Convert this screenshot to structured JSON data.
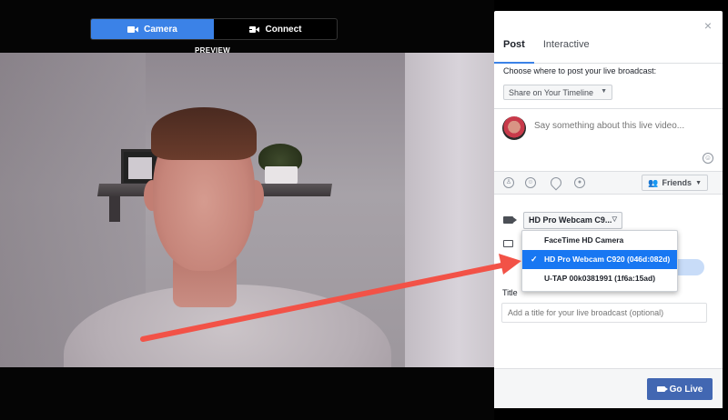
{
  "mode_switch": {
    "camera_label": "Camera",
    "connect_label": "Connect",
    "preview_label": "PREVIEW"
  },
  "panel": {
    "close_glyph": "×",
    "tabs": [
      {
        "label": "Post",
        "active": true
      },
      {
        "label": "Interactive",
        "active": false
      }
    ],
    "choose_text": "Choose where to post your live broadcast:",
    "share_select": {
      "value": "Share on Your Timeline"
    },
    "composer": {
      "placeholder": "Say something about this live video..."
    },
    "actionbar": {
      "icons": [
        "tag-people-icon",
        "feeling-icon",
        "location-icon",
        "sticker-icon"
      ],
      "friends_label": "Friends"
    },
    "camera_select": {
      "value": "HD Pro Webcam C9..."
    },
    "camera_options": [
      {
        "label": "FaceTime HD Camera",
        "selected": false
      },
      {
        "label": "HD Pro Webcam C920 (046d:082d)",
        "selected": true
      },
      {
        "label": "U-TAP 00k0381991 (1f6a:15ad)",
        "selected": false
      }
    ],
    "title_label": "Title",
    "title_input": {
      "placeholder": "Add a title for your live broadcast (optional)"
    },
    "go_live_label": "Go Live"
  },
  "colors": {
    "accent": "#3b82e7",
    "go_live": "#4267b2",
    "annotation_arrow": "#f25247"
  }
}
